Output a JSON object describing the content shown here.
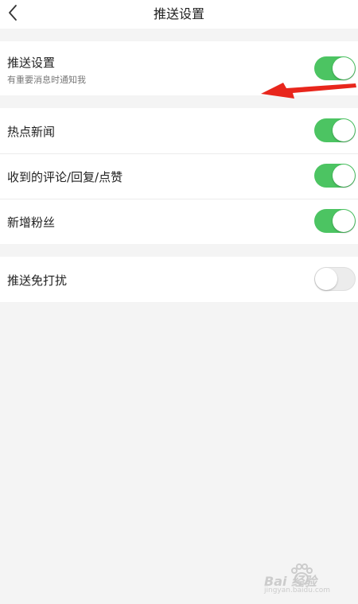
{
  "header": {
    "title": "推送设置",
    "back_icon": "chevron-left-icon"
  },
  "sections": [
    {
      "rows": [
        {
          "title": "推送设置",
          "subtitle": "有重要消息时通知我",
          "toggle_on": true
        }
      ]
    },
    {
      "rows": [
        {
          "title": "热点新闻",
          "toggle_on": true
        },
        {
          "title": "收到的评论/回复/点赞",
          "toggle_on": true
        },
        {
          "title": "新增粉丝",
          "toggle_on": true
        }
      ]
    },
    {
      "rows": [
        {
          "title": "推送免打扰",
          "toggle_on": false
        }
      ]
    }
  ],
  "annotation": {
    "arrow_color": "#e8261c"
  },
  "colors": {
    "toggle_on": "#4cc462",
    "toggle_off": "#ececec",
    "background": "#f4f4f4"
  },
  "watermark": {
    "brand": "Bai 经验",
    "url": "jingyan.baidu.com"
  }
}
